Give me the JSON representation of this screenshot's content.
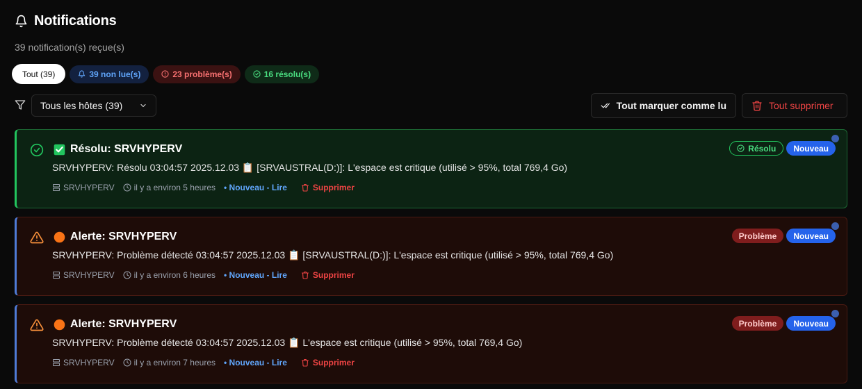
{
  "header": {
    "title": "Notifications",
    "subtitle": "39 notification(s) reçue(s)",
    "icon": "bell-icon"
  },
  "filters": {
    "all": "Tout (39)",
    "unread": "39 non lue(s)",
    "problems": "23 problème(s)",
    "resolved": "16 résolu(s)"
  },
  "toolbar": {
    "host_select": "Tous les hôtes (39)",
    "mark_all_read": "Tout marquer comme lu",
    "delete_all": "Tout supprimer"
  },
  "notifications": [
    {
      "kind": "resolved",
      "title": "Résolu: SRVHYPERV",
      "message": "SRVHYPERV: Résolu 03:04:57 2025.12.03 📋 [SRVAUSTRAL(D:)]: L'espace est critique (utilisé > 95%, total 769,4 Go)",
      "host": "SRVHYPERV",
      "time": "il y a environ 5 heures",
      "read_action": "• Nouveau - Lire",
      "delete_action": "Supprimer",
      "status_badge": "Résolu",
      "new_badge": "Nouveau"
    },
    {
      "kind": "problem",
      "title": "Alerte: SRVHYPERV",
      "message": "SRVHYPERV: Problème détecté 03:04:57 2025.12.03 📋 [SRVAUSTRAL(D:)]: L'espace est critique (utilisé > 95%, total 769,4 Go)",
      "host": "SRVHYPERV",
      "time": "il y a environ 6 heures",
      "read_action": "• Nouveau - Lire",
      "delete_action": "Supprimer",
      "status_badge": "Problème",
      "new_badge": "Nouveau"
    },
    {
      "kind": "problem",
      "title": "Alerte: SRVHYPERV",
      "message": "SRVHYPERV: Problème détecté 03:04:57 2025.12.03 📋 L'espace est critique (utilisé > 95%, total 769,4 Go)",
      "host": "SRVHYPERV",
      "time": "il y a environ 7 heures",
      "read_action": "• Nouveau - Lire",
      "delete_action": "Supprimer",
      "status_badge": "Problème",
      "new_badge": "Nouveau"
    }
  ],
  "colors": {
    "background": "#0a0a0a",
    "resolved": "#22c55e",
    "problem": "#ef4444",
    "accent": "#2563eb",
    "alert_orange": "#f97316"
  }
}
